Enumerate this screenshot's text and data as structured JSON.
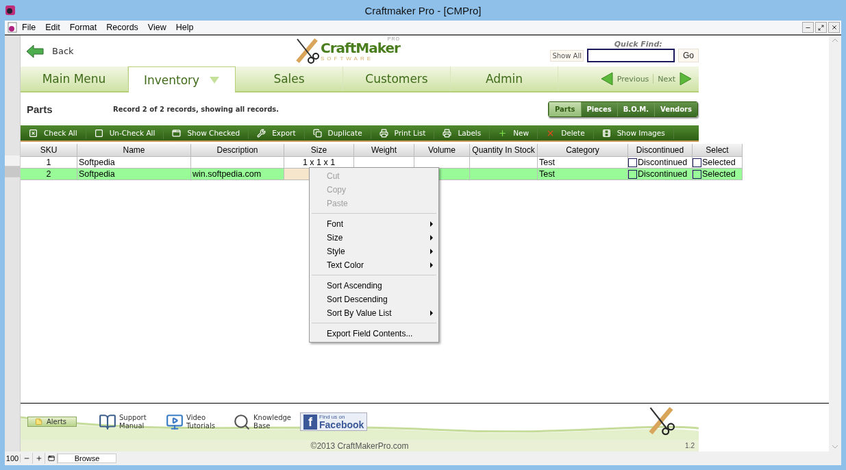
{
  "window": {
    "title": "Craftmaker Pro - [CMPro]"
  },
  "menu_bar": [
    "File",
    "Edit",
    "Format",
    "Records",
    "View",
    "Help"
  ],
  "back": "Back",
  "logo": {
    "name": "CraftMaker",
    "badge": "PRO",
    "tagline": "SOFTWARE"
  },
  "quick_find": {
    "label": "Quick Find:",
    "show_all": "Show All",
    "go": "Go"
  },
  "nav_tabs": [
    {
      "label": "Main Menu",
      "selected": false
    },
    {
      "label": "Inventory",
      "selected": true
    },
    {
      "label": "Sales",
      "selected": false
    },
    {
      "label": "Customers",
      "selected": false
    },
    {
      "label": "Admin",
      "selected": false
    }
  ],
  "pager": {
    "previous": "Previous",
    "next": "Next"
  },
  "page_title": "Parts",
  "record_info": "Record 2 of 2 records, showing all records.",
  "sub_tabs": [
    {
      "label": "Parts",
      "selected": true
    },
    {
      "label": "Pieces",
      "selected": false
    },
    {
      "label": "B.O.M.",
      "selected": false
    },
    {
      "label": "Vendors",
      "selected": false
    }
  ],
  "toolbar": [
    {
      "label": "Check All",
      "kind": "checkall"
    },
    {
      "label": "Un-Check All",
      "kind": "uncheckall"
    },
    {
      "label": "Show Checked",
      "kind": "show"
    },
    {
      "label": "Export",
      "kind": "export"
    },
    {
      "label": "Duplicate",
      "kind": "duplicate"
    },
    {
      "label": "Print List",
      "kind": "print"
    },
    {
      "label": "Labels",
      "kind": "print"
    },
    {
      "label": "New",
      "kind": "new"
    },
    {
      "label": "Delete",
      "kind": "delete"
    },
    {
      "label": "Show Images",
      "kind": "images"
    }
  ],
  "table": {
    "columns": [
      "SKU",
      "Name",
      "Description",
      "Size",
      "Weight",
      "Volume",
      "Quantity In Stock",
      "Category",
      "Discontinued",
      "Select"
    ],
    "rows": [
      {
        "selected": false,
        "cells": [
          {
            "text": "1",
            "active": false
          },
          {
            "text": "Softpedia",
            "active": false
          },
          {
            "text": "",
            "active": false
          },
          {
            "text": "1 x 1 x 1",
            "active": false
          },
          {
            "text": "",
            "active": false
          },
          {
            "text": "",
            "active": false
          },
          {
            "text": "",
            "active": false
          },
          {
            "text": "Test",
            "active": false
          }
        ],
        "checks": [
          {
            "label": "Discontinued",
            "checked": false
          },
          {
            "label": "Selected",
            "checked": false
          }
        ]
      },
      {
        "selected": true,
        "cells": [
          {
            "text": "2",
            "active": false
          },
          {
            "text": "Softpedia",
            "active": false
          },
          {
            "text": "win.softpedia.com",
            "active": false
          },
          {
            "text": "",
            "active": true
          },
          {
            "text": ""
          },
          {
            "text": "",
            "active": false
          },
          {
            "text": "",
            "active": false
          },
          {
            "text": "Test",
            "active": false
          }
        ],
        "checks": [
          {
            "label": "Discontinued",
            "checked": false
          },
          {
            "label": "Selected",
            "checked": false
          }
        ]
      }
    ]
  },
  "context_menu": [
    [
      {
        "label": "Cut",
        "disabled": true,
        "submenu": false
      },
      {
        "label": "Copy",
        "disabled": true,
        "submenu": false
      },
      {
        "label": "Paste",
        "disabled": true,
        "submenu": false
      }
    ],
    [
      {
        "label": "Font",
        "disabled": false,
        "submenu": true
      },
      {
        "label": "Size",
        "disabled": false,
        "submenu": true
      },
      {
        "label": "Style",
        "disabled": false,
        "submenu": true
      },
      {
        "label": "Text Color",
        "disabled": false,
        "submenu": true
      }
    ],
    [
      {
        "label": "Sort Ascending",
        "disabled": false,
        "submenu": false
      },
      {
        "label": "Sort Descending",
        "disabled": false,
        "submenu": false
      },
      {
        "label": "Sort By Value List",
        "disabled": false,
        "submenu": true
      }
    ],
    [
      {
        "label": "Export Field Contents...",
        "disabled": false,
        "submenu": false
      }
    ]
  ],
  "footer": {
    "alerts": "Alerts",
    "links": [
      {
        "label": "Support Manual",
        "kind": "manual"
      },
      {
        "label": "Video Tutorials",
        "kind": "video"
      },
      {
        "label": "Knowledge Base",
        "kind": "knowledge"
      }
    ],
    "facebook": {
      "glyph": "f",
      "small": "Find us on",
      "big": "Facebook"
    },
    "copyright": "©2013 CraftMakerPro.com",
    "version": "1.2"
  },
  "status_bar": {
    "zoom": "100",
    "mode": "Browse"
  }
}
